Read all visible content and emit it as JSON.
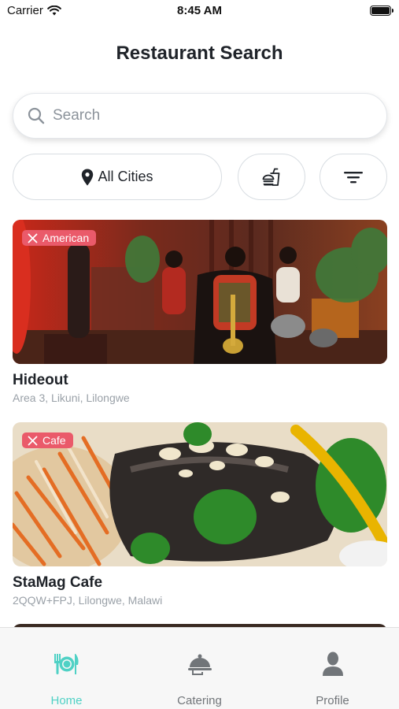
{
  "status_bar": {
    "carrier": "Carrier",
    "time": "8:45 AM"
  },
  "header": {
    "title": "Restaurant Search"
  },
  "search": {
    "placeholder": "Search",
    "icon": "search-icon"
  },
  "filters": {
    "city_label": "All Cities",
    "city_icon": "map-pin-icon",
    "cuisine_icon": "burger-drink-icon",
    "sort_icon": "filter-lines-icon"
  },
  "restaurants": [
    {
      "badge": "American",
      "name": "Hideout",
      "address": "Area 3, Likuni, Lilongwe"
    },
    {
      "badge": "Cafe",
      "name": "StaMag Cafe",
      "address": "2QQW+FPJ, Lilongwe, Malawi"
    }
  ],
  "tabs": [
    {
      "label": "Home",
      "icon": "plate-cutlery-icon",
      "active": true
    },
    {
      "label": "Catering",
      "icon": "cloche-icon",
      "active": false
    },
    {
      "label": "Profile",
      "icon": "person-icon",
      "active": false
    }
  ],
  "colors": {
    "accent": "#4fd1c5",
    "badge": "#ea5a6a",
    "text": "#1f2329",
    "subtext": "#9aa1a8"
  }
}
